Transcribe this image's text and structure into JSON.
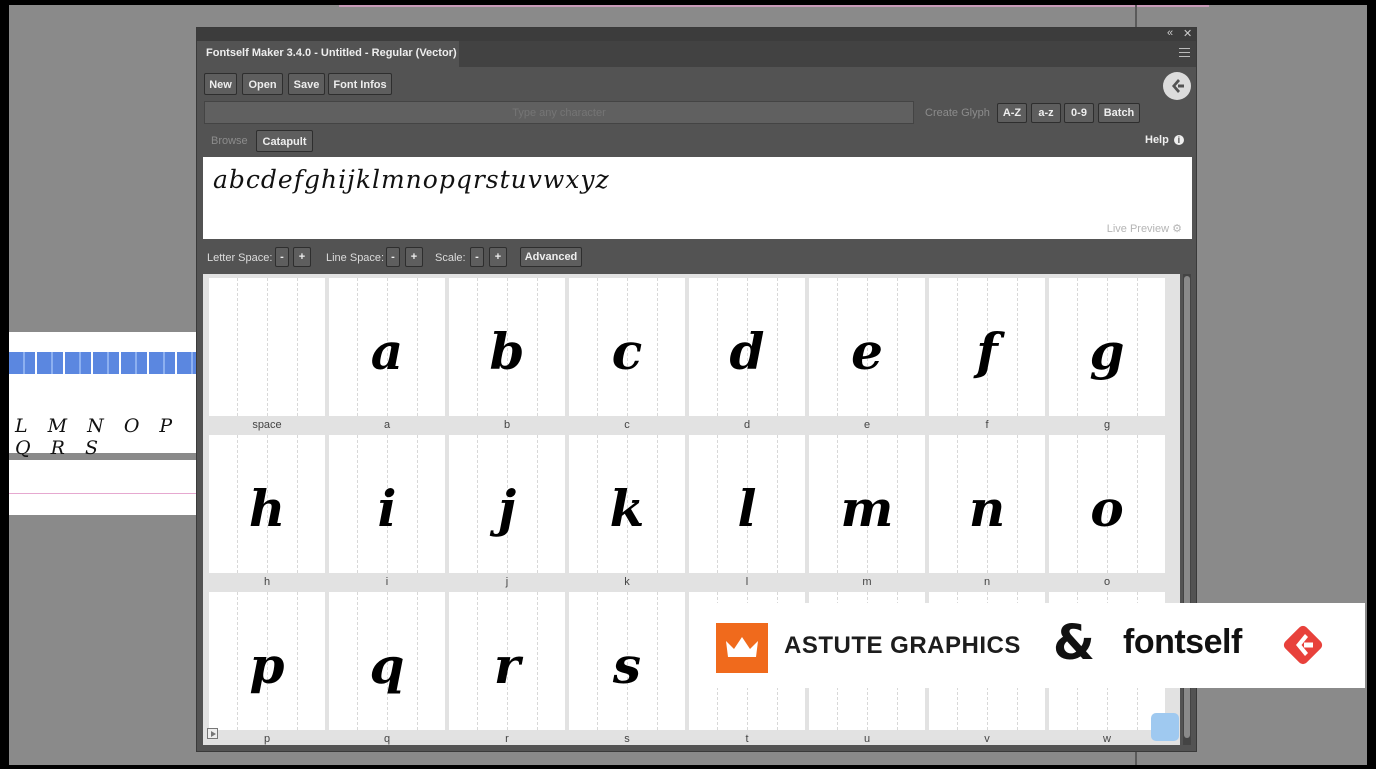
{
  "window": {
    "title": "Fontself Maker 3.4.0 - Untitled - Regular (Vector) *",
    "collapse_glyph": "«",
    "close_glyph": "✕"
  },
  "toolbar": {
    "new": "New",
    "open": "Open",
    "save": "Save",
    "font_infos": "Font Infos"
  },
  "glyph_input": {
    "placeholder": "Type any character",
    "create_label": "Create Glyph"
  },
  "glyph_buttons": {
    "upper": "A-Z",
    "lower": "a-z",
    "digits": "0-9",
    "batch": "Batch"
  },
  "modes": {
    "browse": "Browse",
    "catapult": "Catapult"
  },
  "help": {
    "label": "Help",
    "icon": "info-icon"
  },
  "preview": {
    "text": "abcdefghijklmnopqrstuvwxyz",
    "live_label": "Live Preview"
  },
  "spacing": {
    "letter": "Letter Space:",
    "line": "Line Space:",
    "scale": "Scale:",
    "minus": "-",
    "plus": "+",
    "advanced": "Advanced"
  },
  "glyphs": [
    {
      "label": "space",
      "char": ""
    },
    {
      "label": "a",
      "char": "a"
    },
    {
      "label": "b",
      "char": "b"
    },
    {
      "label": "c",
      "char": "c"
    },
    {
      "label": "d",
      "char": "d"
    },
    {
      "label": "e",
      "char": "e"
    },
    {
      "label": "f",
      "char": "f"
    },
    {
      "label": "g",
      "char": "g"
    },
    {
      "label": "h",
      "char": "h"
    },
    {
      "label": "i",
      "char": "i"
    },
    {
      "label": "j",
      "char": "j"
    },
    {
      "label": "k",
      "char": "k"
    },
    {
      "label": "l",
      "char": "l"
    },
    {
      "label": "m",
      "char": "m"
    },
    {
      "label": "n",
      "char": "n"
    },
    {
      "label": "o",
      "char": "o"
    },
    {
      "label": "p",
      "char": "p"
    },
    {
      "label": "q",
      "char": "q"
    },
    {
      "label": "r",
      "char": "r"
    },
    {
      "label": "s",
      "char": "s"
    },
    {
      "label": "t",
      "char": ""
    },
    {
      "label": "u",
      "char": ""
    },
    {
      "label": "v",
      "char": ""
    },
    {
      "label": "w",
      "char": ""
    }
  ],
  "artboards": {
    "letters_row": "L M N O P Q R S"
  },
  "banner": {
    "company": "ASTUTE GRAPHICS",
    "ampersand": "&",
    "brand": "fontself",
    "accent": "#f06a1c",
    "brand_red": "#e8413b"
  },
  "colors": {
    "panel": "#535353",
    "tab_bar": "#424242",
    "canvas": "#8a8a8a"
  }
}
